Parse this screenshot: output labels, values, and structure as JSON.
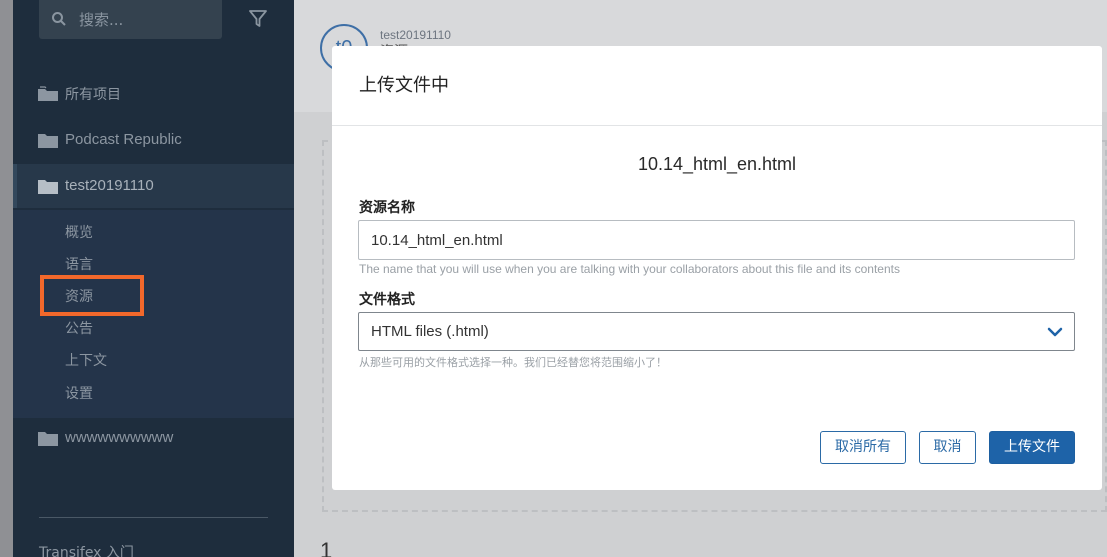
{
  "sidebar": {
    "search_placeholder": "搜索...",
    "items": [
      {
        "label": "所有项目"
      },
      {
        "label": "Podcast Republic"
      },
      {
        "label": "test20191110"
      },
      {
        "label": "wwwwwwwwww"
      }
    ],
    "subitems": [
      "概览",
      "语言",
      "资源",
      "公告",
      "上下文",
      "设置"
    ],
    "footer": "Transifex 入门"
  },
  "main": {
    "avatar_text": "t0",
    "project_name": "test20191110",
    "project_sub": "资源",
    "bottom_number": "1"
  },
  "modal": {
    "title": "上传文件中",
    "file_name": "10.14_html_en.html",
    "resource_name_label": "资源名称",
    "resource_name_value": "10.14_html_en.html",
    "resource_name_help": "The name that you will use when you are talking with your collaborators about this file and its contents",
    "file_format_label": "文件格式",
    "file_format_value": "HTML files (.html)",
    "file_format_help": "从那些可用的文件格式选择一种。我们已经替您将范围缩小了！",
    "buttons": {
      "cancel_all": "取消所有",
      "cancel": "取消",
      "upload": "上传文件"
    }
  },
  "colors": {
    "sidebar_bg": "#1e2d3d",
    "highlight": "#f2682b",
    "primary": "#1e63a8"
  }
}
